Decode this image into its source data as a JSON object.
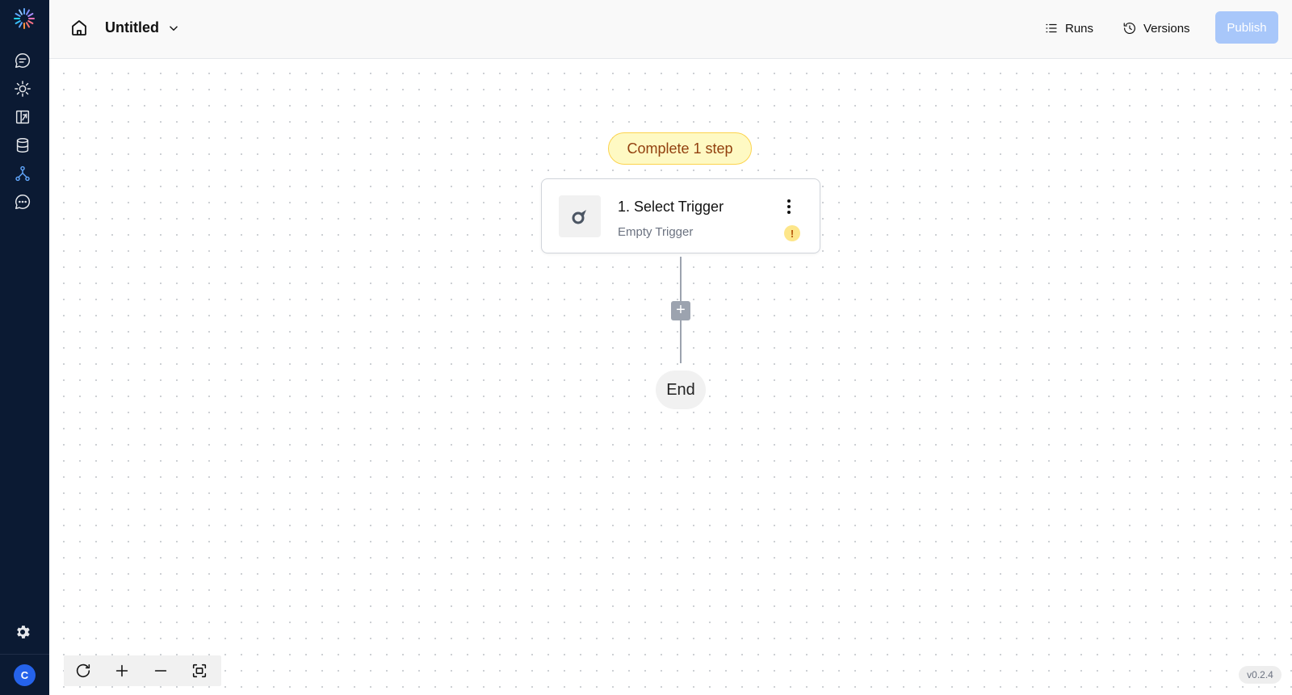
{
  "header": {
    "flow_title": "Untitled",
    "runs_label": "Runs",
    "versions_label": "Versions",
    "publish_label": "Publish"
  },
  "sidebar": {
    "items": [
      {
        "icon": "chat-icon"
      },
      {
        "icon": "sun-icon"
      },
      {
        "icon": "tables-icon"
      },
      {
        "icon": "database-icon"
      },
      {
        "icon": "flows-icon",
        "active": true
      },
      {
        "icon": "message-dots-icon"
      }
    ],
    "settings_icon": "gear-icon",
    "avatar_letter": "C"
  },
  "canvas": {
    "status_badge": "Complete 1 step",
    "trigger": {
      "title": "1. Select Trigger",
      "subtitle": "Empty Trigger",
      "warning": "!"
    },
    "add_step_symbol": "+",
    "end_label": "End"
  },
  "controls": {
    "buttons": [
      "reset-view-icon",
      "zoom-in-icon",
      "zoom-out-icon",
      "fit-view-icon"
    ]
  },
  "version": "v0.2.4",
  "colors": {
    "sidebar_bg": "#0b1a33",
    "accent": "#2563eb",
    "publish_disabled": "#a8c7fa",
    "badge_bg": "#fef9c3",
    "badge_text": "#92400e"
  }
}
